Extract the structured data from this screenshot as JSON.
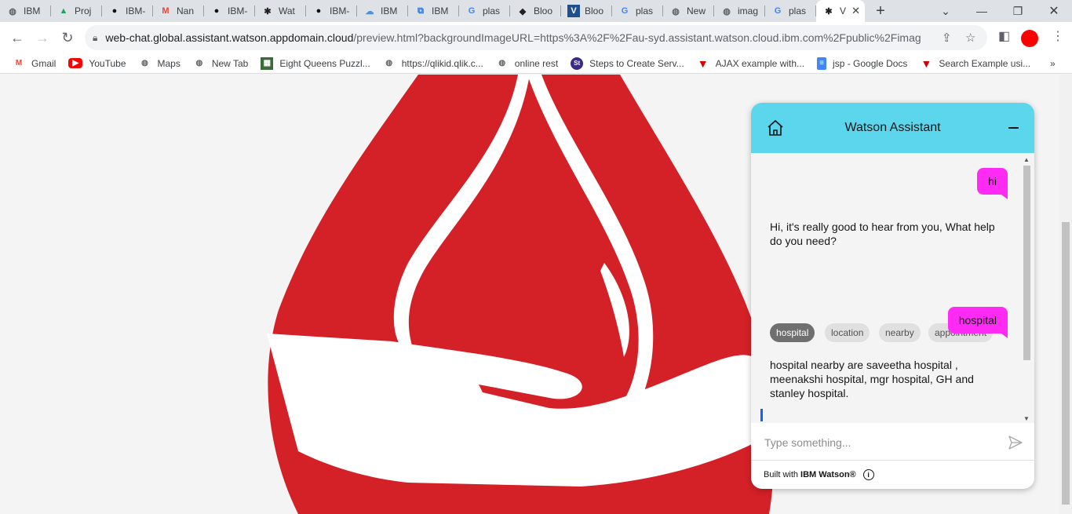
{
  "browser": {
    "tabs": [
      {
        "label": "IBM",
        "icon": "globe-icon"
      },
      {
        "label": "Proj",
        "icon": "google-drive-icon"
      },
      {
        "label": "IBM-",
        "icon": "github-icon"
      },
      {
        "label": "Nan",
        "icon": "gmail-icon"
      },
      {
        "label": "IBM-",
        "icon": "github-icon"
      },
      {
        "label": "Wat",
        "icon": "watson-icon"
      },
      {
        "label": "IBM-",
        "icon": "github-icon"
      },
      {
        "label": "IBM",
        "icon": "cloud-icon"
      },
      {
        "label": "IBM",
        "icon": "ibm-cloud-icon"
      },
      {
        "label": "plas",
        "icon": "google-icon"
      },
      {
        "label": "Bloo",
        "icon": "blood-icon"
      },
      {
        "label": "Bloo",
        "icon": "v-icon"
      },
      {
        "label": "plas",
        "icon": "google-icon"
      },
      {
        "label": "New",
        "icon": "globe-icon"
      },
      {
        "label": "imag",
        "icon": "globe-icon"
      },
      {
        "label": "plas",
        "icon": "google-icon"
      }
    ],
    "active_tab": {
      "label": "V",
      "icon": "watson-icon"
    },
    "new_tab_label": "+",
    "url_host": "web-chat.global.assistant.watson.appdomain.cloud",
    "url_rest": "/preview.html?backgroundImageURL=https%3A%2F%2Fau-syd.assistant.watson.cloud.ibm.com%2Fpublic%2Fimages%...",
    "bookmarks": [
      {
        "label": "Gmail",
        "icon": "gmail-icon"
      },
      {
        "label": "YouTube",
        "icon": "youtube-icon"
      },
      {
        "label": "Maps",
        "icon": "globe-icon"
      },
      {
        "label": "New Tab",
        "icon": "globe-icon"
      },
      {
        "label": "Eight Queens Puzzl...",
        "icon": "image-icon"
      },
      {
        "label": "https://qlikid.qlik.c...",
        "icon": "globe-icon"
      },
      {
        "label": "online rest",
        "icon": "globe-icon"
      },
      {
        "label": "Steps to Create Serv...",
        "icon": "st-icon"
      },
      {
        "label": "AJAX example with...",
        "icon": "t-icon"
      },
      {
        "label": "jsp - Google Docs",
        "icon": "docs-icon"
      },
      {
        "label": "Search Example usi...",
        "icon": "t-icon"
      }
    ],
    "bookmarks_more": "»"
  },
  "chat": {
    "title": "Watson Assistant",
    "messages": {
      "user_1": "hi",
      "bot_1": "Hi, it's really good to hear from you, What help do you need?",
      "options": [
        "hospital",
        "location",
        "nearby",
        "appointment"
      ],
      "user_2": "hospital",
      "bot_2": "hospital nearby are saveetha hospital , meenakshi hospital, mgr hospital, GH and stanley hospital."
    },
    "input_placeholder": "Type something...",
    "footer_prefix": "Built with",
    "footer_brand": "IBM Watson®",
    "help_label": "?",
    "info_label": "i"
  },
  "colors": {
    "header": "#5bd6ec",
    "user_bubble": "#ff2bf5",
    "drop_red": "#d42027",
    "help_button": "#0f62fe"
  }
}
